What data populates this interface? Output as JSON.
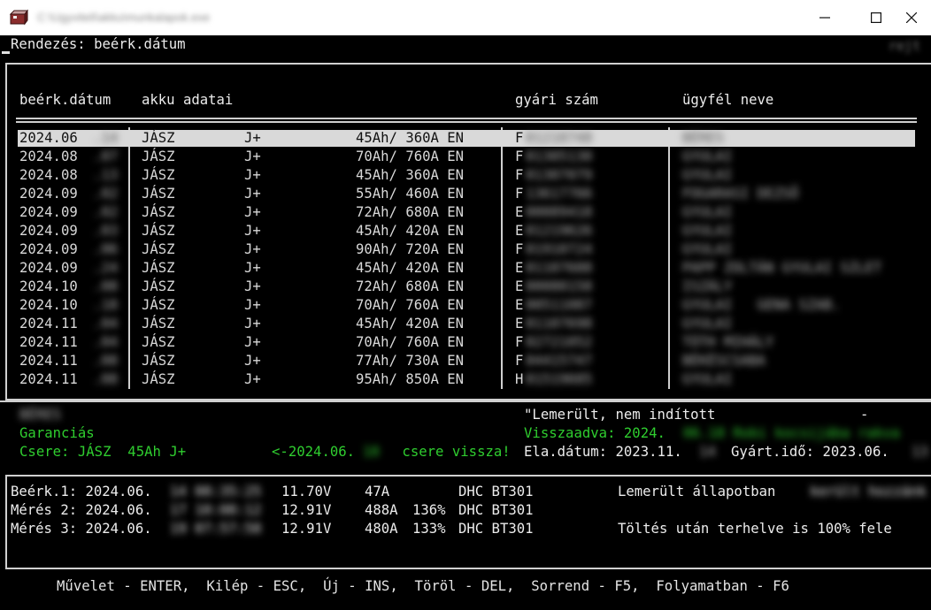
{
  "window": {
    "title": "C:\\Ugyviteli\\akku\\munkalapok.exe",
    "buttons": {
      "minimize": "—",
      "maximize": "☐",
      "close": "✕"
    }
  },
  "sort": {
    "label": "Rendezés: beérk.dátum",
    "hidden_tag": "rejt"
  },
  "list": {
    "headers": {
      "date": "beérk.dátum",
      "akku": "akku adatai",
      "serial": "gyári szám",
      "customer": "ügyfél neve"
    },
    "rows": [
      {
        "date": "2024.06",
        "date_hidden": ".14",
        "brand": "JÁSZ",
        "type": "J+",
        "capacity": "45Ah/ 360A EN",
        "serial_prefix": "F",
        "serial_hidden": "01218748",
        "customer": "BÉRES",
        "selected": true
      },
      {
        "date": "2024.08",
        "date_hidden": ".07",
        "brand": "JÁSZ",
        "type": "J+",
        "capacity": "70Ah/ 760A EN",
        "serial_prefix": "F",
        "serial_hidden": "01305130",
        "customer": "GYULAI"
      },
      {
        "date": "2024.08",
        "date_hidden": ".13",
        "brand": "JÁSZ",
        "type": "J+",
        "capacity": "45Ah/ 360A EN",
        "serial_prefix": "F",
        "serial_hidden": "01307079",
        "customer": "GYULAI"
      },
      {
        "date": "2024.09",
        "date_hidden": ".02",
        "brand": "JÁSZ",
        "type": "J+",
        "capacity": "55Ah/ 460A EN",
        "serial_prefix": "F",
        "serial_hidden": "13617766",
        "customer": "FOGARASI DEZSŐ"
      },
      {
        "date": "2024.09",
        "date_hidden": ".02",
        "brand": "JÁSZ",
        "type": "J+",
        "capacity": "72Ah/ 680A EN",
        "serial_prefix": "E",
        "serial_hidden": "00089418",
        "customer": "GYULAI"
      },
      {
        "date": "2024.09",
        "date_hidden": ".03",
        "brand": "JÁSZ",
        "type": "J+",
        "capacity": "45Ah/ 420A EN",
        "serial_prefix": "E",
        "serial_hidden": "01219626",
        "customer": "GYULAI"
      },
      {
        "date": "2024.09",
        "date_hidden": ".06",
        "brand": "JÁSZ",
        "type": "J+",
        "capacity": "90Ah/ 720A EN",
        "serial_prefix": "F",
        "serial_hidden": "01910724",
        "customer": "GYULAI"
      },
      {
        "date": "2024.09",
        "date_hidden": ".24",
        "brand": "JÁSZ",
        "type": "J+",
        "capacity": "45Ah/ 420A EN",
        "serial_prefix": "E",
        "serial_hidden": "01107688",
        "customer": "PAPP ZOLTÁN GYULAI SZLET"
      },
      {
        "date": "2024.10",
        "date_hidden": ".08",
        "brand": "JÁSZ",
        "type": "J+",
        "capacity": "72Ah/ 680A EN",
        "serial_prefix": "E",
        "serial_hidden": "00080158",
        "customer": "ISZÁLY"
      },
      {
        "date": "2024.10",
        "date_hidden": ".18",
        "brand": "JÁSZ",
        "type": "J+",
        "capacity": "70Ah/ 760A EN",
        "serial_prefix": "E",
        "serial_hidden": "00511087",
        "customer": "GYULAI   GENA SZAB."
      },
      {
        "date": "2024.11",
        "date_hidden": ".04",
        "brand": "JÁSZ",
        "type": "J+",
        "capacity": "45Ah/ 420A EN",
        "serial_prefix": "E",
        "serial_hidden": "01107698",
        "customer": "GYULAI"
      },
      {
        "date": "2024.11",
        "date_hidden": ".04",
        "brand": "JÁSZ",
        "type": "J+",
        "capacity": "70Ah/ 760A EN",
        "serial_prefix": "F",
        "serial_hidden": "02721052",
        "customer": "TÓTH MIHÁLY"
      },
      {
        "date": "2024.11",
        "date_hidden": ".08",
        "brand": "JÁSZ",
        "type": "J+",
        "capacity": "77Ah/ 730A EN",
        "serial_prefix": "F",
        "serial_hidden": "04415747",
        "customer": "BÉKÉSCSABA"
      },
      {
        "date": "2024.11",
        "date_hidden": ".08",
        "brand": "JÁSZ",
        "type": "J+",
        "capacity": "95Ah/ 850A EN",
        "serial_prefix": "H",
        "serial_hidden": "01519685",
        "customer": "GYULAI"
      }
    ]
  },
  "detail": {
    "customer_hidden": "BÉRES",
    "status": "Garanciás",
    "swap_label": "Csere: JÁSZ  45Ah J+",
    "swap_date": "<-2024.06.",
    "swap_date_hidden": "18",
    "swap_tail": " csere vissza!",
    "complaint": "\"Lemerült, nem indított",
    "dash": "-",
    "returned": "Visszaadva: 2024.",
    "returned_hidden": "06.18 Robi kocsijába rakva",
    "ela": "Ela.dátum: 2023.11.",
    "ela_hidden": "14",
    "gyart": "Gyárt.idő: 2023.06.",
    "gyart_hidden": "13"
  },
  "measurements": [
    {
      "label": "Beérk.1: 2024.06.",
      "time_hidden": "14 08:35:25",
      "voltage": "11.70V",
      "current": "47A",
      "percent": "",
      "device": "DHC BT301",
      "note": "Lemerült állapotban",
      "note_hidden": " került hozzánk"
    },
    {
      "label": "Mérés 2: 2024.06.",
      "time_hidden": "17 10:08:12",
      "voltage": "12.91V",
      "current": "488A",
      "percent": "136%",
      "device": "DHC BT301",
      "note": "",
      "note_hidden": ""
    },
    {
      "label": "Mérés 3: 2024.06.",
      "time_hidden": "19 07:57:58",
      "voltage": "12.91V",
      "current": "480A",
      "percent": "133%",
      "device": "DHC BT301",
      "note": "Töltés után terhelve is 100% fele",
      "note_hidden": ""
    }
  ],
  "footer": "Művelet - ENTER,  Kilép - ESC,  Új - INS,  Töröl - DEL,  Sorrend - F5,  Folyamatban - F6",
  "colors": {
    "background": "#000000",
    "text": "#d8d8d8",
    "accent_green": "#2fcd2f",
    "selection": "#d9d9d9"
  }
}
